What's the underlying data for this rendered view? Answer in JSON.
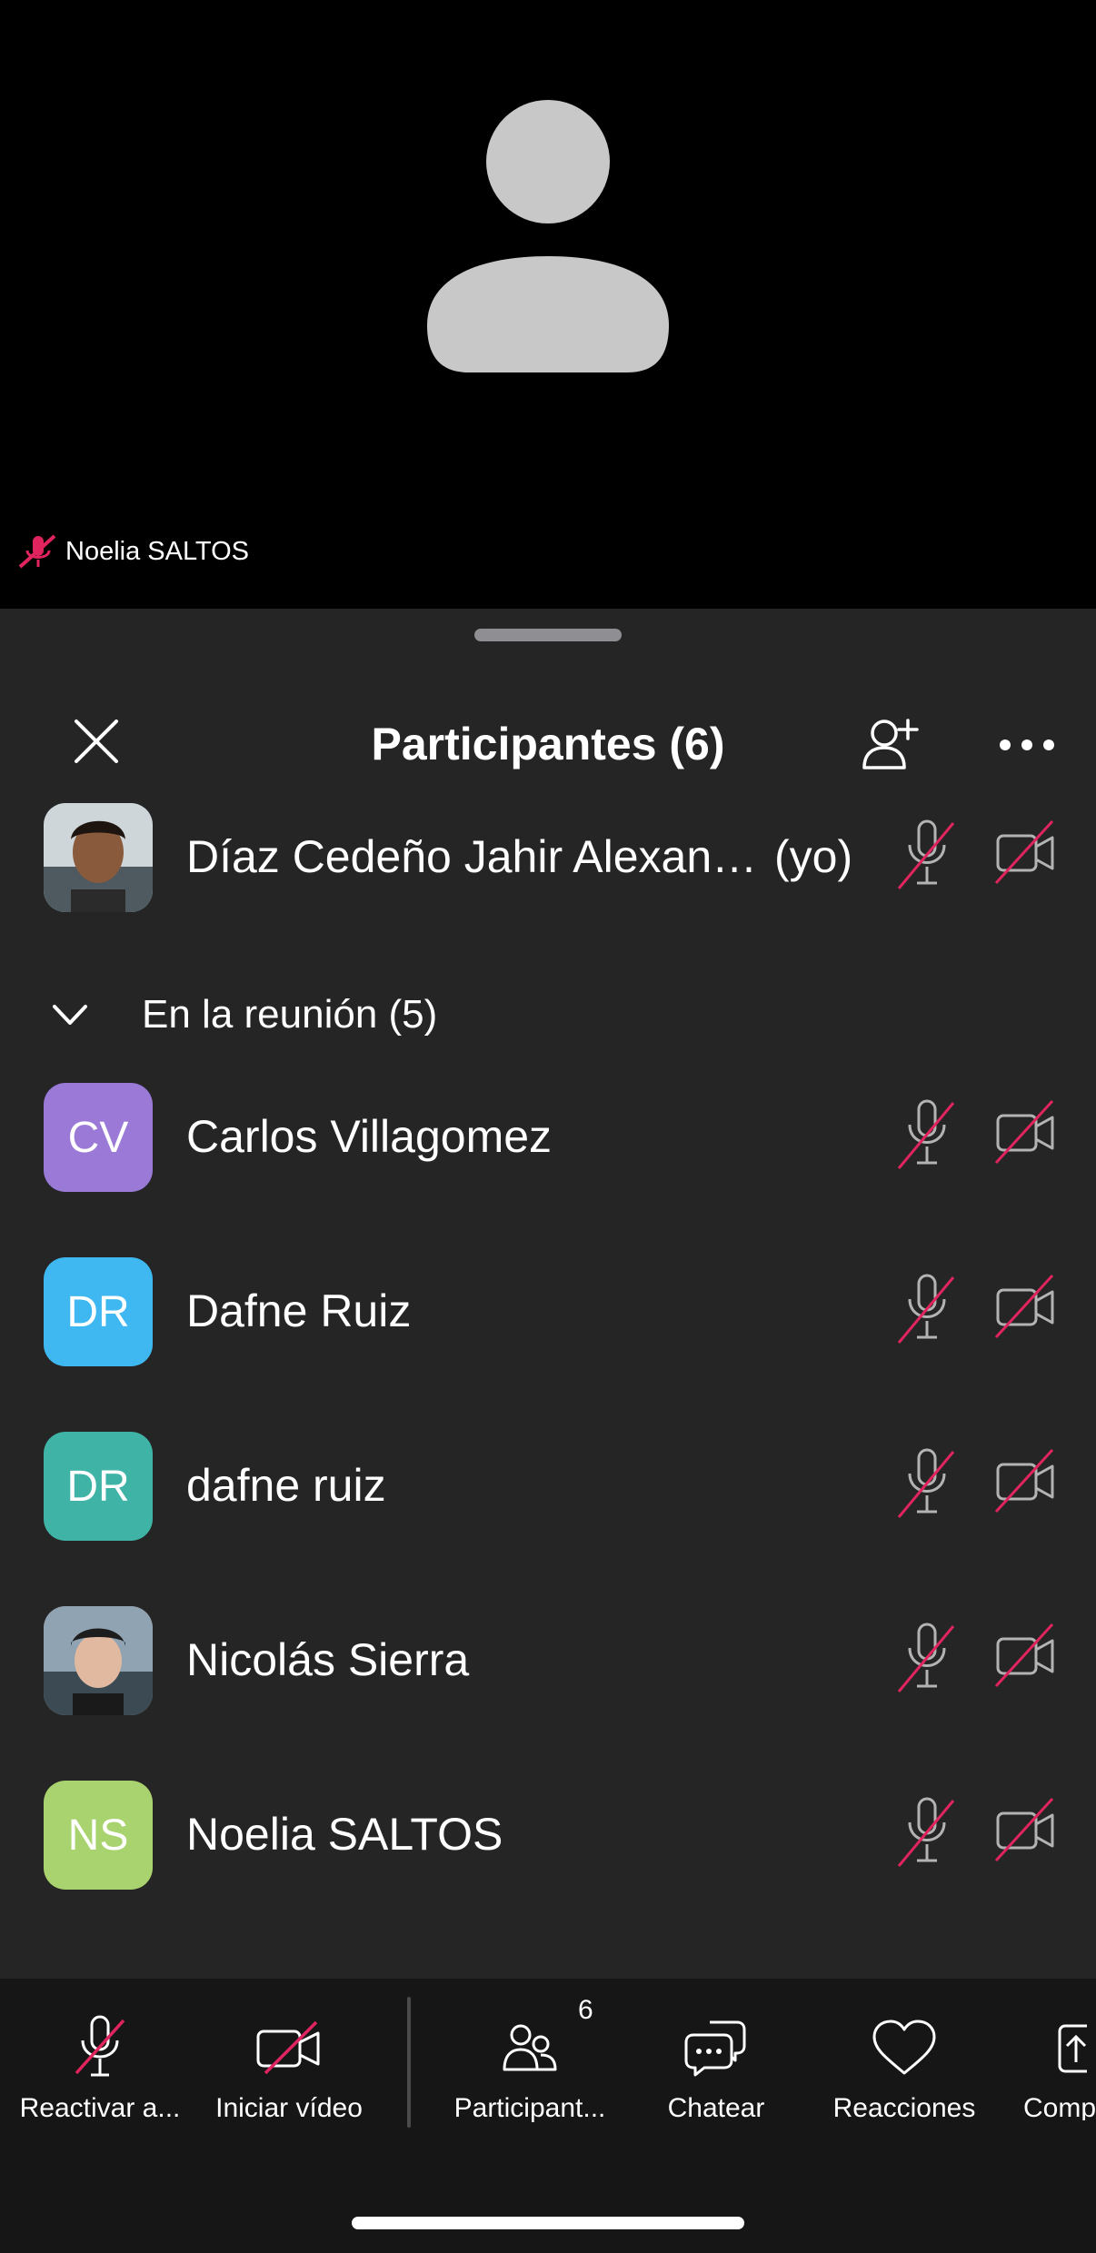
{
  "stage": {
    "speaker_name": "Noelia SALTOS",
    "speaker_muted_icon": "mic-off-icon",
    "placeholder_icon": "person-silhouette-icon"
  },
  "sheet": {
    "title": "Participantes (6)",
    "close_icon": "close-icon",
    "add_icon": "add-person-icon",
    "more_icon": "more-horizontal-icon"
  },
  "self": {
    "name": "Díaz Cedeño Jahir Alexan…",
    "tag": "(yo)",
    "avatar_type": "photo"
  },
  "section": {
    "label": "En la reunión (5)",
    "collapsed": false
  },
  "participants": [
    {
      "name": "Carlos Villagomez",
      "initials": "CV",
      "color": "#9b79d6",
      "avatar_type": "initials"
    },
    {
      "name": "Dafne Ruiz",
      "initials": "DR",
      "color": "#3fb7f0",
      "avatar_type": "initials"
    },
    {
      "name": "dafne ruiz",
      "initials": "DR",
      "color": "#3fb3a6",
      "avatar_type": "initials"
    },
    {
      "name": "Nicolás Sierra",
      "initials": "",
      "color": "#6c7a86",
      "avatar_type": "photo"
    },
    {
      "name": "Noelia SALTOS",
      "initials": "NS",
      "color": "#a9d36e",
      "avatar_type": "initials"
    }
  ],
  "toolbar": {
    "unmute_label": "Reactivar a...",
    "video_label": "Iniciar vídeo",
    "participants_label": "Participant...",
    "participants_badge": "6",
    "chat_label": "Chatear",
    "reactions_label": "Reacciones",
    "share_label": "Comp"
  },
  "colors": {
    "stage_bg": "#000000",
    "sheet_bg": "#252526",
    "toolbar_bg": "#161616",
    "muted_slash": "#e0245e",
    "icon_gray": "#b3b3b3"
  }
}
